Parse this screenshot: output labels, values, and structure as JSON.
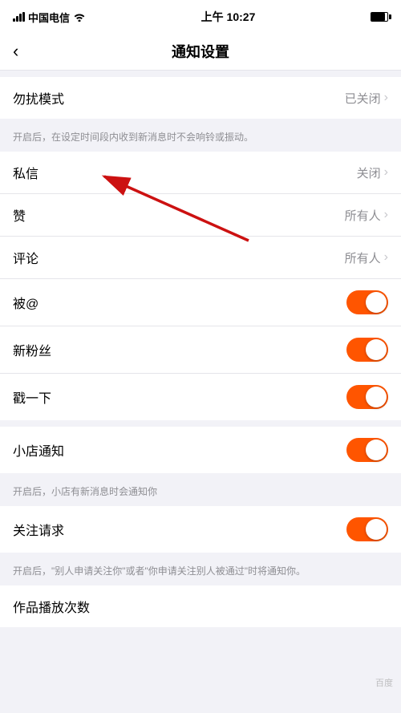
{
  "statusBar": {
    "carrier": "中国电信",
    "time": "上午 10:27",
    "wifiIcon": "wifi",
    "batteryLevel": 85
  },
  "nav": {
    "back": "‹",
    "title": "通知设置"
  },
  "sections": [
    {
      "id": "dnd",
      "items": [
        {
          "label": "勿扰模式",
          "valueText": "已关闭",
          "type": "chevron"
        }
      ],
      "note": "开启后，在设定时间段内收到新消息时不会响铃或振动。"
    },
    {
      "id": "messages",
      "items": [
        {
          "label": "私信",
          "valueText": "关闭",
          "type": "chevron"
        },
        {
          "label": "赞",
          "valueText": "所有人",
          "type": "chevron"
        },
        {
          "label": "评论",
          "valueText": "所有人",
          "type": "chevron"
        },
        {
          "label": "被@",
          "valueText": "",
          "type": "toggle",
          "toggleOn": true
        },
        {
          "label": "新粉丝",
          "valueText": "",
          "type": "toggle",
          "toggleOn": true
        },
        {
          "label": "戳一下",
          "valueText": "",
          "type": "toggle",
          "toggleOn": true
        }
      ]
    },
    {
      "id": "shop",
      "items": [
        {
          "label": "小店通知",
          "valueText": "",
          "type": "toggle",
          "toggleOn": true
        }
      ],
      "note": "开启后，小店有新消息时会通知你"
    },
    {
      "id": "follow",
      "items": [
        {
          "label": "关注请求",
          "valueText": "",
          "type": "toggle",
          "toggleOn": true
        }
      ],
      "note": "开启后，\"别人申请关注你\"或者\"你申请关注别人被通过\"时将通知你。"
    },
    {
      "id": "playcount",
      "items": [
        {
          "label": "作品播放次数",
          "valueText": "",
          "type": "none"
        }
      ]
    }
  ]
}
